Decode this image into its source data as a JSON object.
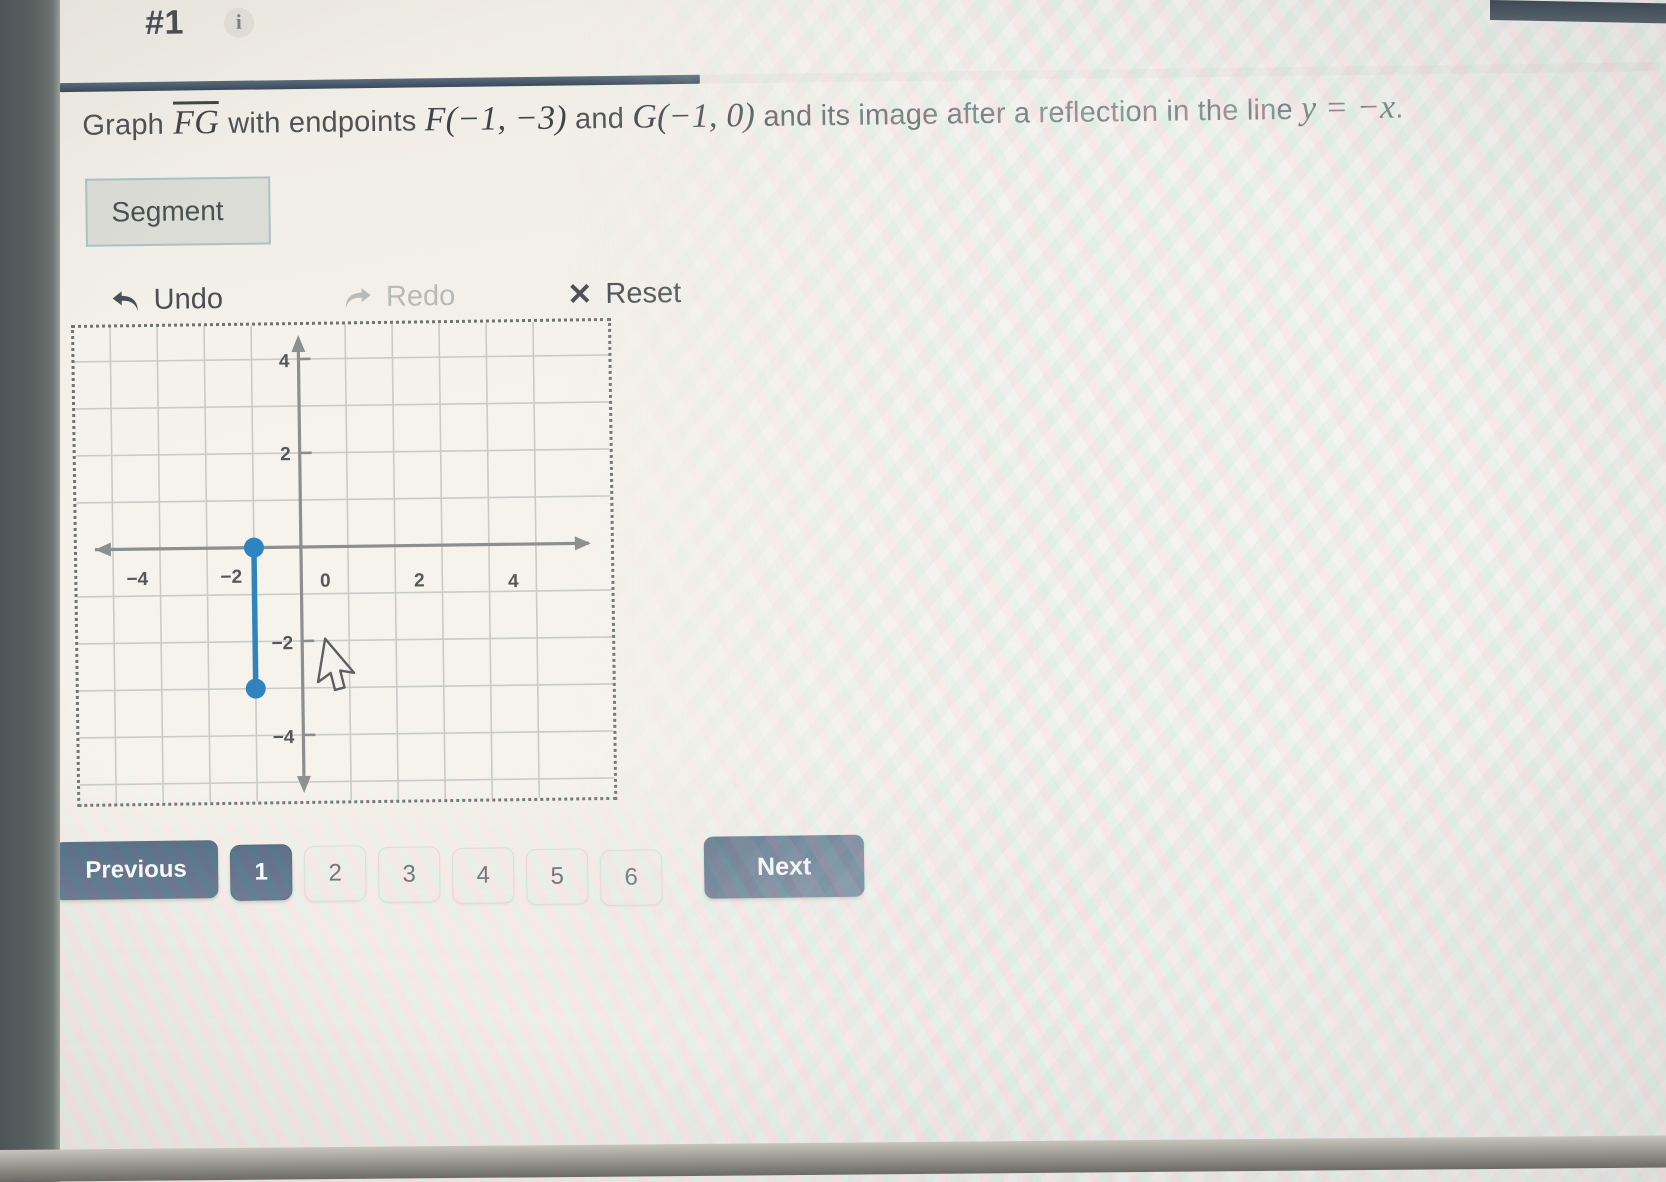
{
  "header": {
    "question_number": "#1",
    "info_icon": "info-icon",
    "progress_percent": 40
  },
  "prompt": {
    "lead": "Graph",
    "segment_name": "FG",
    "mid": "with endpoints",
    "point_f": "F(−1, −3)",
    "conj": "and",
    "point_g": "G(−1, 0)",
    "tail": "and its image after a reflection in the line",
    "line_equation": "y = −x",
    "period": "."
  },
  "toolbar": {
    "segment_tool_label": "Segment",
    "undo_label": "Undo",
    "undo_icon": "undo-arrow-icon",
    "redo_label": "Redo",
    "redo_icon": "redo-arrow-icon",
    "reset_label": "Reset",
    "reset_icon": "close-x-icon",
    "redo_disabled": true
  },
  "chart_data": {
    "type": "scatter",
    "title": "",
    "xlabel": "",
    "ylabel": "",
    "xlim": [
      -5,
      5
    ],
    "ylim": [
      -5,
      5
    ],
    "grid": true,
    "legend_position": "none",
    "x_tick_labels": [
      "−4",
      "−2",
      "0",
      "2",
      "4"
    ],
    "x_tick_values": [
      -4,
      -2,
      0,
      2,
      4
    ],
    "y_tick_labels": [
      "4",
      "2",
      "−2",
      "−4"
    ],
    "y_tick_values": [
      4,
      2,
      -2,
      -4
    ],
    "grid_step": 1,
    "segment_color": "#2f84bf",
    "axis_color": "#8b8f8d",
    "grid_color": "#c9cbc6",
    "series": [
      {
        "name": "Segment FG",
        "points": [
          {
            "label": "G",
            "x": -1,
            "y": 0
          },
          {
            "label": "F",
            "x": -1,
            "y": -3
          }
        ]
      }
    ],
    "annotations": [
      {
        "type": "cursor",
        "x": 0.45,
        "y": -2.1,
        "icon": "mouse-pointer-icon"
      }
    ]
  },
  "pagination": {
    "previous_label": "Previous",
    "next_label": "Next",
    "pages": [
      "1",
      "2",
      "3",
      "4",
      "5",
      "6"
    ],
    "active_page": "1"
  },
  "colors": {
    "accent": "#46617c",
    "segment_blue": "#2f84bf",
    "tool_border": "#a9c3c9",
    "page_background": "#f2efe8"
  }
}
